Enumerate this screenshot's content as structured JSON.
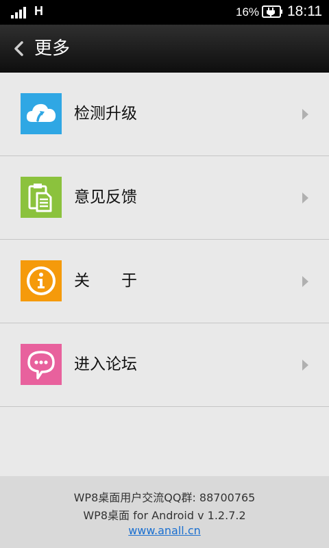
{
  "status_bar": {
    "network_type": "H",
    "battery_percent": "16%",
    "time": "18:11"
  },
  "header": {
    "title": "更多"
  },
  "menu": {
    "items": [
      {
        "label": "检测升级",
        "icon": "cloud-upload-icon",
        "color": "#2fa7e4"
      },
      {
        "label": "意见反馈",
        "icon": "clipboard-icon",
        "color": "#8bc23d"
      },
      {
        "label": "关　　于",
        "icon": "info-icon",
        "color": "#f59a0b"
      },
      {
        "label": "进入论坛",
        "icon": "chat-bubble-icon",
        "color": "#e8619d"
      }
    ]
  },
  "footer": {
    "qq_group": "WP8桌面用户交流QQ群: 88700765",
    "version": "WP8桌面 for Android v 1.2.7.2",
    "website": "www.anall.cn"
  },
  "colors": {
    "background": "#e9e9e9",
    "footer_background": "#d9d9d9",
    "link": "#1a6fd0"
  }
}
